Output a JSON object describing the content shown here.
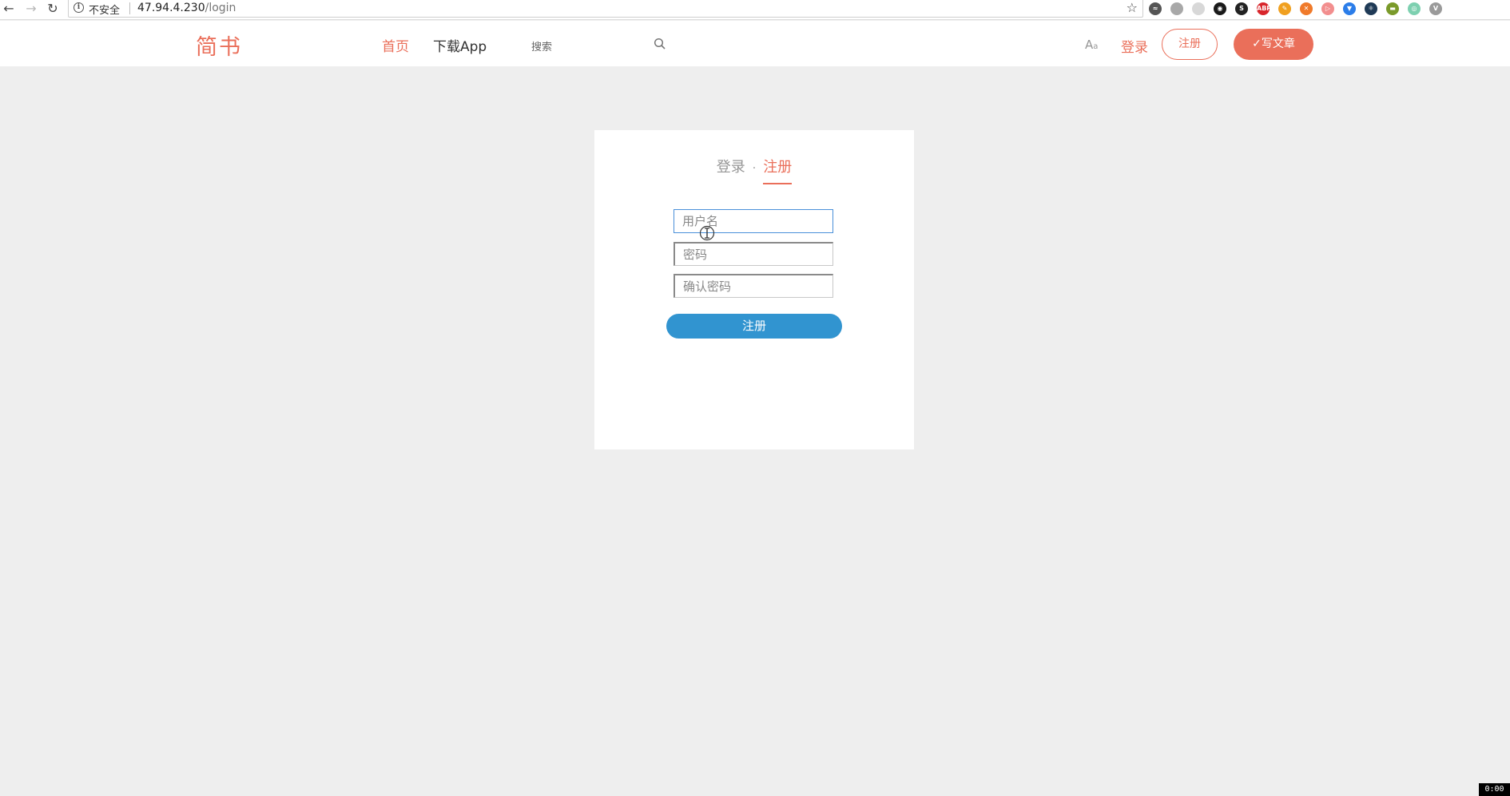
{
  "browser": {
    "security_label": "不安全",
    "url_host": "47.94.4.230",
    "url_path": "/login",
    "extensions": [
      {
        "name": "extension-1",
        "color": "#555555",
        "glyph": "≈"
      },
      {
        "name": "extension-2",
        "color": "#a8a8a8",
        "glyph": ""
      },
      {
        "name": "extension-3",
        "color": "#d8d8d8",
        "glyph": ""
      },
      {
        "name": "extension-4",
        "color": "#1a1a1a",
        "glyph": "◉"
      },
      {
        "name": "extension-5",
        "color": "#222222",
        "glyph": "S"
      },
      {
        "name": "adblock-plus",
        "color": "#d8262c",
        "glyph": "ABP"
      },
      {
        "name": "extension-7",
        "color": "#f0a020",
        "glyph": "✎"
      },
      {
        "name": "extension-8",
        "color": "#f07a2a",
        "glyph": "✕"
      },
      {
        "name": "extension-9",
        "color": "#f28e8e",
        "glyph": "▷"
      },
      {
        "name": "extension-10",
        "color": "#2b7de9",
        "glyph": "▼"
      },
      {
        "name": "extension-11",
        "color": "#1f3a56",
        "glyph": "⚛"
      },
      {
        "name": "extension-12",
        "color": "#7a9a2a",
        "glyph": "▬"
      },
      {
        "name": "extension-13",
        "color": "#7dd0b0",
        "glyph": "◎"
      },
      {
        "name": "extension-14",
        "color": "#9a9a9a",
        "glyph": "V"
      }
    ]
  },
  "header": {
    "logo": "简书",
    "nav_home": "首页",
    "nav_app": "下载App",
    "search_placeholder": "搜索",
    "font_toggle": "A",
    "font_toggle_small": "a",
    "login": "登录",
    "register": "注册",
    "write": "写文章"
  },
  "card": {
    "tab_login": "登录",
    "tab_separator": "·",
    "tab_register": "注册",
    "username_placeholder": "用户名",
    "password_placeholder": "密码",
    "confirm_placeholder": "确认密码",
    "submit": "注册"
  },
  "colors": {
    "brand": "#ea6f5a",
    "submit": "#3194d0",
    "background": "#eeeeee"
  },
  "timecode": "0:00"
}
